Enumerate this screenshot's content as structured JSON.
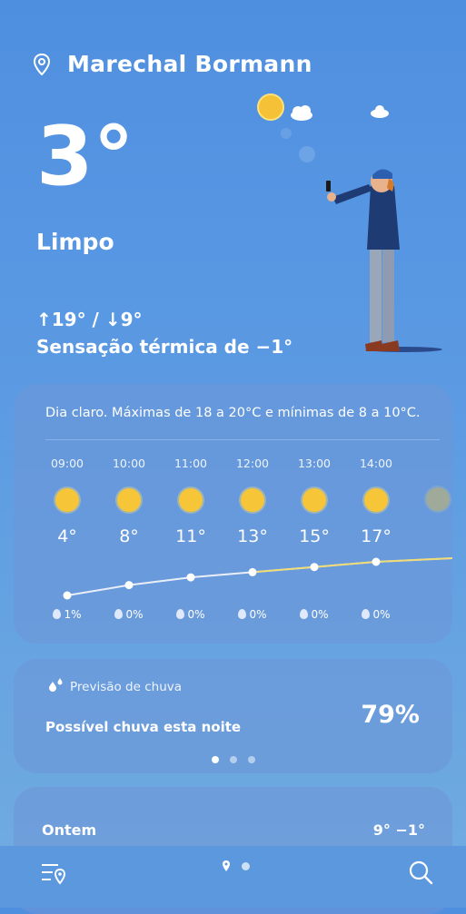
{
  "location": "Marechal Bormann",
  "current": {
    "temperature": "3°",
    "condition": "Limpo",
    "high_low": "↑19° / ↓9°",
    "feels_like": "Sensação térmica de −1°"
  },
  "hourly": {
    "summary": "Dia claro. Máximas de 18 a 20°C e mínimas de 8 a 10°C.",
    "hours": [
      {
        "time": "09:00",
        "temp": "4°",
        "temp_value": 4,
        "rain": "1%",
        "icon": "sun-cloud-icon"
      },
      {
        "time": "10:00",
        "temp": "8°",
        "temp_value": 8,
        "rain": "0%",
        "icon": "sun-icon"
      },
      {
        "time": "11:00",
        "temp": "11°",
        "temp_value": 11,
        "rain": "0%",
        "icon": "sun-icon"
      },
      {
        "time": "12:00",
        "temp": "13°",
        "temp_value": 13,
        "rain": "0%",
        "icon": "sun-icon"
      },
      {
        "time": "13:00",
        "temp": "15°",
        "temp_value": 15,
        "rain": "0%",
        "icon": "sun-icon"
      },
      {
        "time": "14:00",
        "temp": "17°",
        "temp_value": 17,
        "rain": "0%",
        "icon": "sun-icon"
      }
    ]
  },
  "rain_forecast": {
    "title": "Previsão de chuva",
    "message": "Possível chuva esta noite",
    "percent": "79%"
  },
  "history": {
    "label": "Ontem",
    "values": "9° −1°"
  },
  "colors": {
    "sun": "#f6c538",
    "line_warm": "#f1d54a",
    "background_top": "#4f8fe0"
  }
}
